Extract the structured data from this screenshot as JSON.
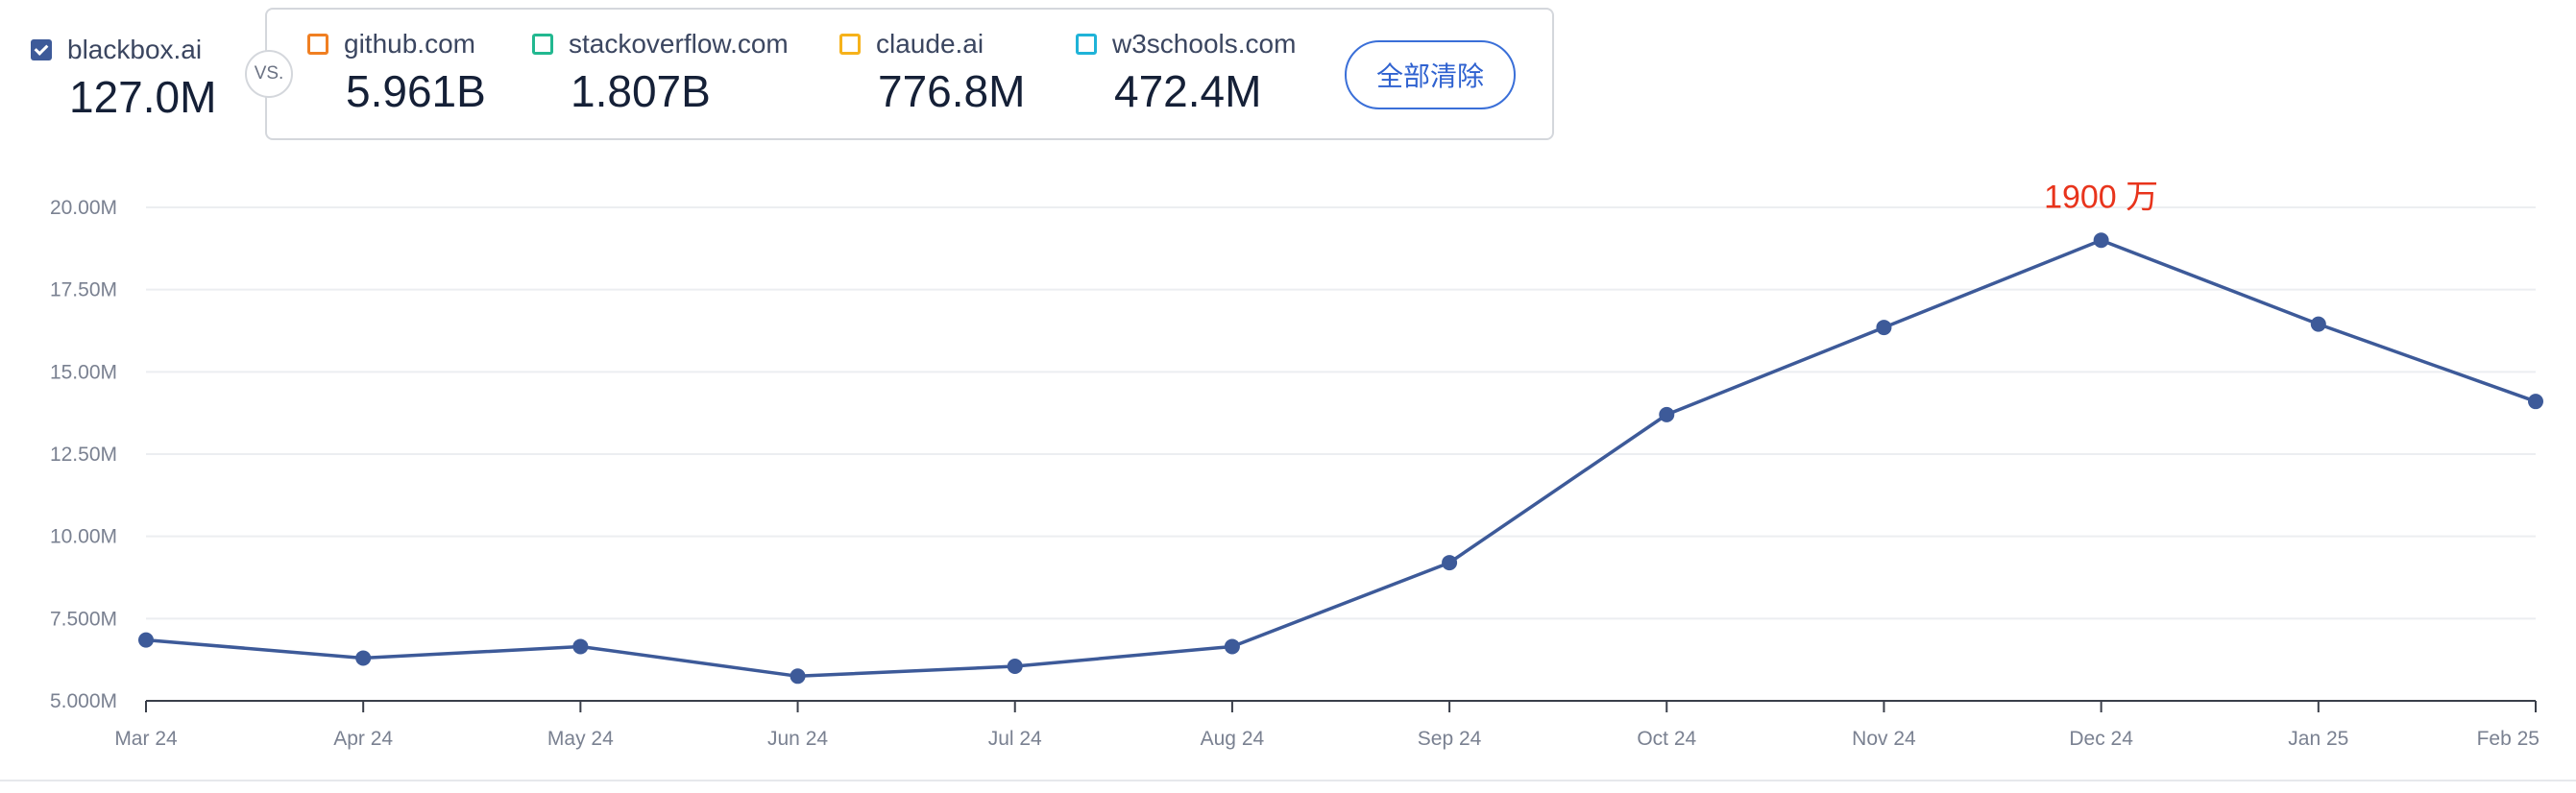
{
  "main_site": {
    "name": "blackbox.ai",
    "value": "127.0M",
    "color": "#3d5a99",
    "checked": true
  },
  "vs_label": "VS.",
  "competitors": [
    {
      "name": "github.com",
      "value": "5.961B",
      "color": "#f07f22"
    },
    {
      "name": "stackoverflow.com",
      "value": "1.807B",
      "color": "#22b890"
    },
    {
      "name": "claude.ai",
      "value": "776.8M",
      "color": "#f6b21b"
    },
    {
      "name": "w3schools.com",
      "value": "472.4M",
      "color": "#1fb3d8"
    }
  ],
  "clear_button": {
    "label": "全部清除"
  },
  "chart_data": {
    "type": "line",
    "x": [
      "Mar 24",
      "Apr 24",
      "May 24",
      "Jun 24",
      "Jul 24",
      "Aug 24",
      "Sep 24",
      "Oct 24",
      "Nov 24",
      "Dec 24",
      "Jan 25",
      "Feb 25"
    ],
    "series": [
      {
        "values": [
          6.85,
          6.3,
          6.65,
          5.75,
          6.05,
          6.65,
          9.2,
          13.7,
          16.35,
          19.0,
          16.45,
          14.1
        ],
        "color": "#3d5a99"
      }
    ],
    "ylim": [
      5.0,
      20.0
    ],
    "yticks": [
      5.0,
      7.5,
      10.0,
      12.5,
      15.0,
      17.5,
      20.0
    ],
    "ytick_labels": [
      "5.000M",
      "7.500M",
      "10.00M",
      "12.50M",
      "15.00M",
      "17.50M",
      "20.00M"
    ],
    "annotation": {
      "text": "1900 万",
      "x_index": 9,
      "color": "#e8341c"
    },
    "grid": true,
    "title": "",
    "xlabel": "",
    "ylabel": ""
  }
}
